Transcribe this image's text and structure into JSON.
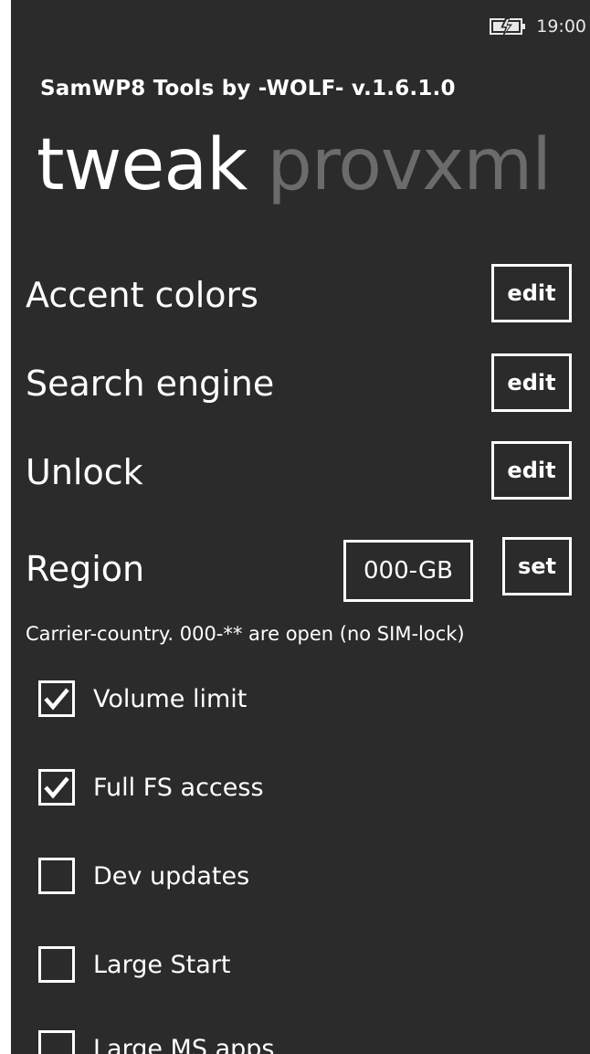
{
  "status": {
    "time": "19:00",
    "battery_icon": "battery-charging-icon"
  },
  "app": {
    "title": "SamWP8 Tools by -WOLF- v.1.6.1.0"
  },
  "pivot": {
    "active": "tweak",
    "inactive": "provxml"
  },
  "settings": [
    {
      "label": "Accent colors",
      "button": "edit"
    },
    {
      "label": "Search engine",
      "button": "edit"
    },
    {
      "label": "Unlock",
      "button": "edit"
    }
  ],
  "region": {
    "label": "Region",
    "value": "000-GB",
    "button": "set"
  },
  "hint": "Carrier-country. 000-** are open (no SIM-lock)",
  "options": [
    {
      "label": "Volume limit",
      "checked": true
    },
    {
      "label": "Full FS access",
      "checked": true
    },
    {
      "label": "Dev updates",
      "checked": false
    },
    {
      "label": "Large Start",
      "checked": false
    },
    {
      "label": "Large MS apps",
      "checked": false
    }
  ],
  "colors": {
    "background": "#2b2b2b",
    "foreground": "#ffffff",
    "inactive_pivot": "#6b6b6b"
  }
}
